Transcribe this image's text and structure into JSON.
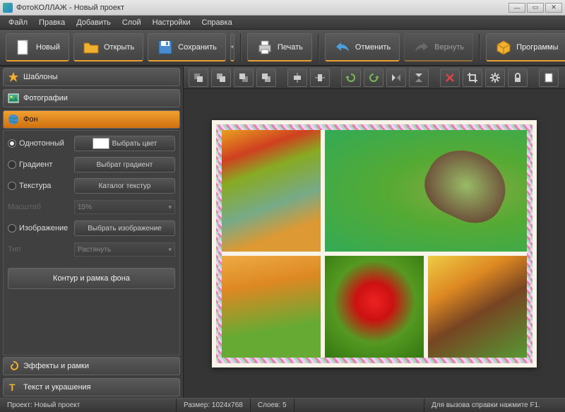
{
  "window": {
    "title": "ФотоКОЛЛАЖ - Новый проект"
  },
  "menu": {
    "file": "Файл",
    "edit": "Правка",
    "add": "Добавить",
    "layer": "Слой",
    "settings": "Настройки",
    "help": "Справка"
  },
  "toolbar": {
    "new": "Новый",
    "open": "Открыть",
    "save": "Сохранить",
    "print": "Печать",
    "undo": "Отменить",
    "redo": "Вернуть",
    "programs": "Программы"
  },
  "sidebar": {
    "templates": "Шаблоны",
    "photos": "Фотографии",
    "background": "Фон",
    "effects": "Эффекты и рамки",
    "text": "Текст и украшения"
  },
  "bgpanel": {
    "solid": "Однотонный",
    "pick_color": "Выбрать цвет",
    "gradient": "Градиент",
    "pick_gradient": "Выбрат градиент",
    "texture": "Текстура",
    "texture_catalog": "Каталог текстур",
    "scale_label": "Масштаб",
    "scale_value": "15%",
    "image": "Изображение",
    "pick_image": "Выбрать изображение",
    "type_label": "Тип",
    "type_value": "Растянуть",
    "contour_btn": "Контур и рамка фона"
  },
  "status": {
    "project": "Проект: Новый проект",
    "size": "Размер: 1024x768",
    "layers": "Слоев: 5",
    "help": "Для вызова справки нажмите F1."
  }
}
